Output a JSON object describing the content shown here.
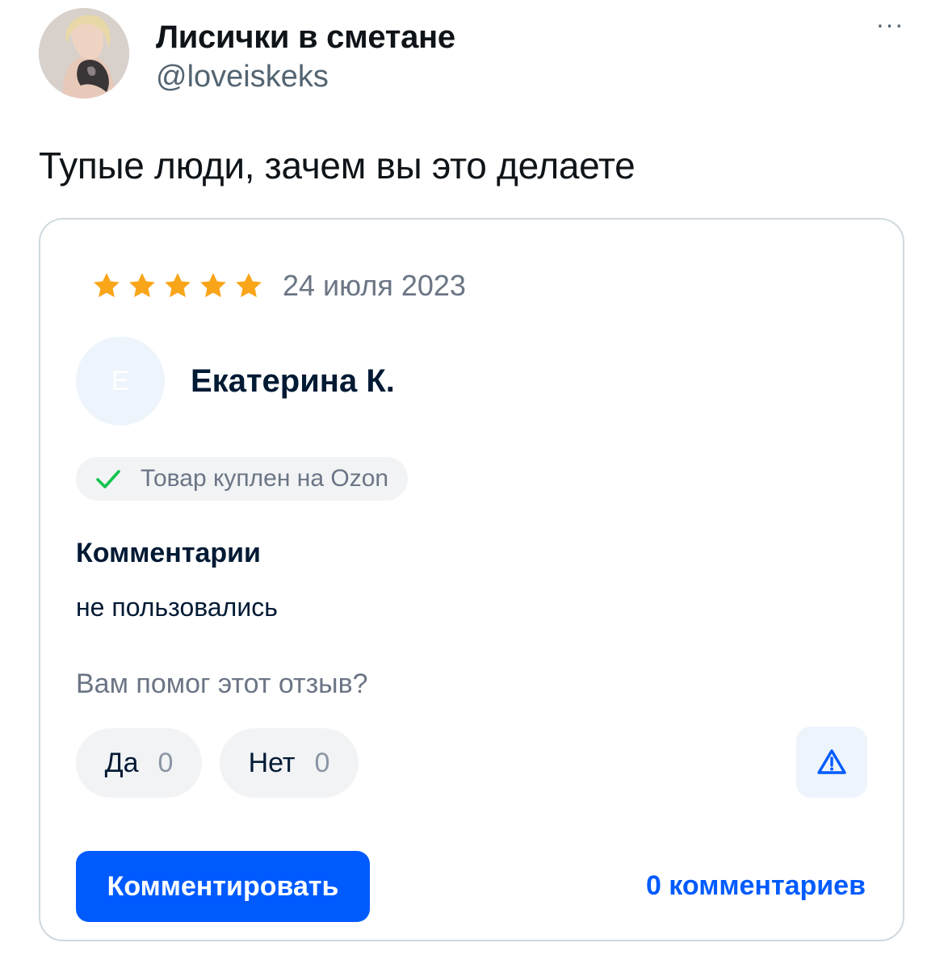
{
  "tweet": {
    "author_name": "Лисички в сметане",
    "author_handle": "@loveiskeks",
    "more_label": "···",
    "text": "Тупые люди, зачем вы это делаете"
  },
  "review": {
    "rating": 5,
    "rating_max": 5,
    "date": "24 июля 2023",
    "reviewer_initial": "Е",
    "reviewer_name": "Екатерина К.",
    "verified_text": "Товар куплен на Ozon",
    "comments_heading": "Комментарии",
    "comment": "не пользовались",
    "helpful_question": "Вам помог этот отзыв?",
    "vote_yes_label": "Да",
    "vote_yes_count": "0",
    "vote_no_label": "Нет",
    "vote_no_count": "0",
    "comment_button_label": "Комментировать",
    "comments_count_label": "0 комментариев"
  },
  "icons": {
    "star": "star-icon",
    "verified": "checkmark-icon",
    "report": "warning-icon",
    "more": "more-dots-icon"
  },
  "colors": {
    "star": "#f9a51a",
    "accent": "#005bff",
    "check": "#10c44c",
    "report_icon": "#005bff"
  }
}
